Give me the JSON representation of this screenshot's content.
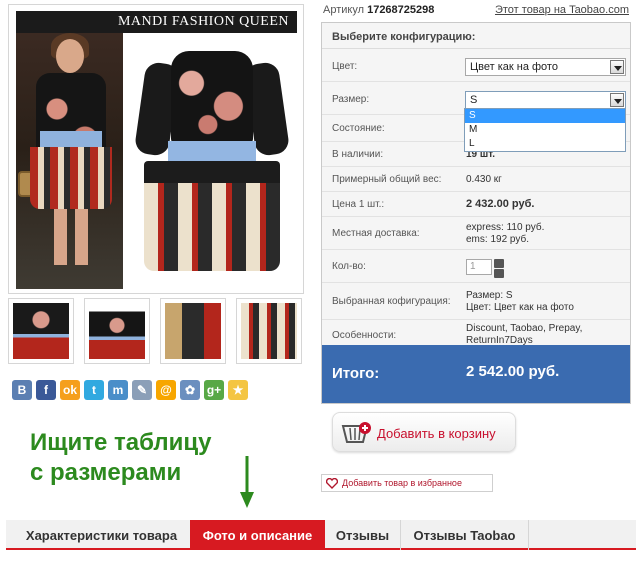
{
  "product": {
    "brand_overlay": "MANDI FASHION QUEEN",
    "article_label": "Артикул",
    "article_number": "17268725298",
    "taobao_link": "Этот товар на Taobao.com"
  },
  "config": {
    "title": "Выберите конфигурацию:",
    "color_label": "Цвет:",
    "color_value": "Цвет как на фото",
    "size_label": "Размер:",
    "size_value": "S",
    "size_options": [
      "S",
      "M",
      "L"
    ],
    "condition_label": "Состояние:",
    "stock_label": "В наличии:",
    "stock_value": "19 шт.",
    "weight_label": "Примерный общий вес:",
    "weight_value": "0.430 кг",
    "price_label": "Цена 1 шт.:",
    "price_value": "2 432.00 руб.",
    "delivery_label": "Местная доставка:",
    "delivery_express": "express: 110 руб.",
    "delivery_ems": "ems: 192 руб.",
    "qty_label": "Кол-во:",
    "qty_value": "1",
    "selected_label": "Выбранная кофигурация:",
    "selected_size": "Размер: S",
    "selected_color": "Цвет: Цвет как на фото",
    "features_label": "Особенности:",
    "features_line1": "Discount, Taobao, Prepay,",
    "features_line2": "ReturnIn7Days",
    "total_label": "Итого:",
    "total_value": "2 542.00 руб."
  },
  "actions": {
    "add_to_cart": "Добавить в корзину",
    "add_to_favorites": "Добавить товар в избранное"
  },
  "share": {
    "icons": [
      "vk-icon",
      "facebook-icon",
      "odnoklassniki-icon",
      "twitter-icon",
      "moimir-icon",
      "livejournal-icon",
      "mailru-icon",
      "settings-icon",
      "googleplus-icon",
      "star-icon"
    ],
    "glyphs": [
      "B",
      "f",
      "ok",
      "t",
      "m",
      "✎",
      "@",
      "✿",
      "g+",
      "★"
    ],
    "colors": [
      "#5b7fb2",
      "#3b5998",
      "#f59f1d",
      "#31a9e0",
      "#4a8ec9",
      "#8b9fb8",
      "#f7a600",
      "#6b8fbf",
      "#58a846",
      "#f4c542"
    ]
  },
  "hint": {
    "line1": "Ищите таблицу",
    "line2": "с размерами",
    "color": "#2c8a1e"
  },
  "tabs": [
    {
      "label": "Характеристики товара",
      "active": false
    },
    {
      "label": "Фото и описание",
      "active": true
    },
    {
      "label": "Отзывы",
      "active": false
    },
    {
      "label": "Отзывы Taobao",
      "active": false
    }
  ],
  "colors": {
    "accent_red": "#d71a21",
    "total_bar": "#3a6bb0",
    "dropdown_highlight": "#3399ff"
  }
}
